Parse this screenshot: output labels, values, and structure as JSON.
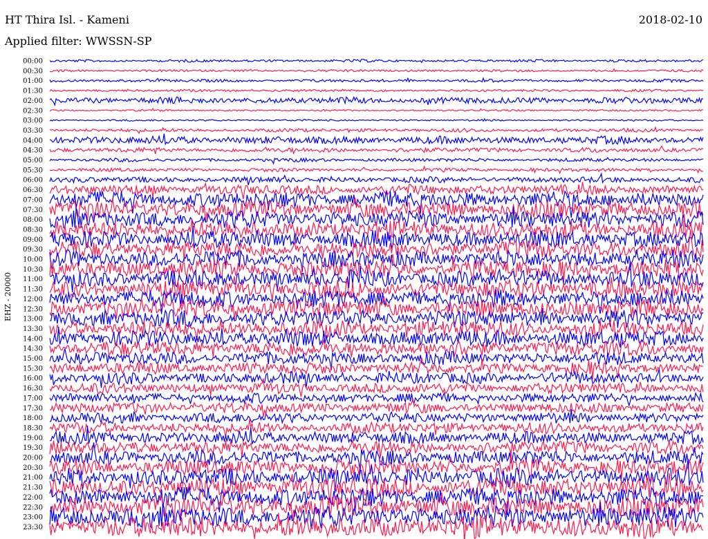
{
  "header": {
    "station": "HT Thira Isl. - Kameni",
    "date": "2018-02-10",
    "filter": "Applied filter: WWSSN-SP",
    "channel": "EHZ - 20000"
  },
  "chart_data": {
    "type": "line",
    "title": "HT Thira Isl. - Kameni",
    "time_labels": [
      "00:00",
      "00:30",
      "01:00",
      "01:30",
      "02:00",
      "02:30",
      "03:00",
      "03:30",
      "04:00",
      "04:30",
      "05:00",
      "05:30",
      "06:00",
      "06:30",
      "07:00",
      "07:30",
      "08:00",
      "08:30",
      "09:00",
      "09:30",
      "10:00",
      "10:30",
      "11:00",
      "11:30",
      "12:00",
      "12:30",
      "13:00",
      "13:30",
      "14:00",
      "14:30",
      "15:00",
      "15:30",
      "16:00",
      "16:30",
      "17:00",
      "17:30",
      "18:00",
      "18:30",
      "19:00",
      "19:30",
      "20:00",
      "20:30",
      "21:00",
      "21:30",
      "22:00",
      "22:30",
      "23:00",
      "23:30"
    ],
    "trace_colors": [
      "#0000ff",
      "#ff1a4d"
    ],
    "relative_amplitude": [
      0.45,
      0.4,
      0.5,
      0.4,
      1.1,
      0.3,
      0.3,
      0.6,
      1.3,
      0.8,
      0.6,
      0.6,
      1.0,
      1.7,
      2.8,
      2.8,
      2.9,
      2.9,
      2.9,
      2.9,
      2.9,
      3.0,
      3.0,
      3.0,
      3.0,
      3.0,
      2.9,
      2.8,
      2.7,
      2.6,
      2.2,
      2.0,
      2.0,
      1.8,
      1.7,
      1.8,
      1.8,
      1.9,
      2.1,
      2.3,
      2.5,
      2.7,
      3.0,
      3.2,
      3.4,
      3.5,
      3.6,
      3.7
    ]
  }
}
